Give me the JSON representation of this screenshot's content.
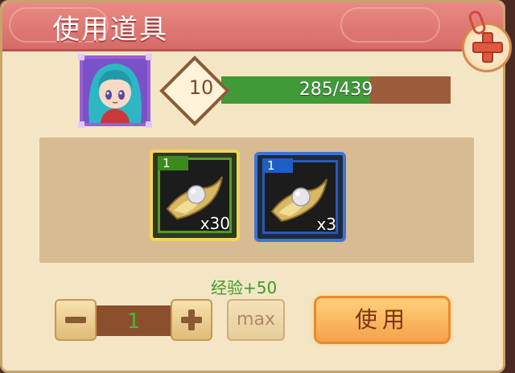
{
  "window": {
    "title": "使用道具"
  },
  "hero": {
    "level": "10",
    "xp_text": "285/439",
    "xp_fraction": 0.649
  },
  "items": [
    {
      "level": "1",
      "count": "x30",
      "frame_color": "#f6d45a",
      "icon": "gem-wing-icon",
      "selected": true
    },
    {
      "level": "1",
      "count": "x3",
      "frame_color": "#3c74d6",
      "icon": "gem-wing-icon",
      "selected": false
    }
  ],
  "reward": {
    "text": "经验+50"
  },
  "quantity": {
    "value": "1",
    "minus_icon": "minus-icon",
    "plus_icon": "plus-icon"
  },
  "buttons": {
    "max_label": "max",
    "use_label": "使用"
  },
  "colors": {
    "title_bar": "#d66b67",
    "xp_fill": "#3f9a37",
    "xp_track": "#9b5d3b",
    "reward_text": "#3e9a2e"
  }
}
